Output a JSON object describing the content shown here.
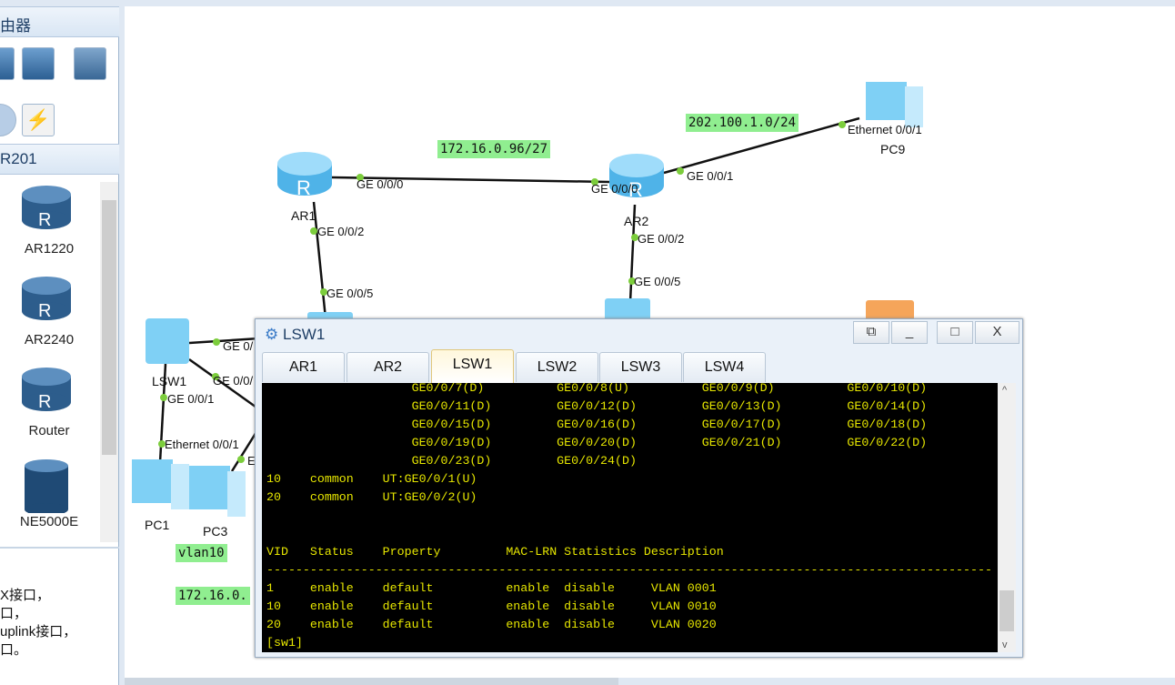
{
  "left_panel": {
    "section_title": "由器",
    "device_family": "R201",
    "devices": [
      {
        "label": "AR1220"
      },
      {
        "label": "AR2240"
      },
      {
        "label": "Router"
      },
      {
        "label": "NE5000E"
      }
    ],
    "description_lines": [
      "X接口，",
      "口，",
      "uplink接口，",
      "口。"
    ]
  },
  "topology": {
    "networks": [
      "172.16.0.96/27",
      "202.100.1.0/24",
      "vlan10",
      "172.16.0."
    ],
    "devices": {
      "ar1": "AR1",
      "ar2": "AR2",
      "lsw1": "LSW1",
      "pc1": "PC1",
      "pc3": "PC3",
      "pc9": "PC9"
    },
    "ports": {
      "ar1_g0": "GE 0/0/0",
      "ar2_g0": "GE 0/0/0",
      "ar2_g1": "GE 0/0/1",
      "pc9_e": "Ethernet 0/0/1",
      "ar1_g2": "GE 0/0/2",
      "sw_g5a": "GE 0/0/5",
      "ar2_g2": "GE 0/0/2",
      "sw_g5b": "GE 0/0/5",
      "lsw1_a": "GE 0/",
      "lsw1_b": "GE 0/0/",
      "lsw1_g1": "GE 0/0/1",
      "pc1_e": "Ethernet 0/0/1",
      "pc3_e": "E"
    }
  },
  "console": {
    "title": "LSW1",
    "buttons": {
      "restore": "⧉",
      "minimize": "_",
      "maximize": "□",
      "close": "X"
    },
    "tabs": [
      {
        "label": "AR1"
      },
      {
        "label": "AR2"
      },
      {
        "label": "LSW1",
        "active": true
      },
      {
        "label": "LSW2"
      },
      {
        "label": "LSW3"
      },
      {
        "label": "LSW4"
      }
    ],
    "output": "                    GE0/0/7(D)          GE0/0/8(U)          GE0/0/9(D)          GE0/0/10(D)\n                    GE0/0/11(D)         GE0/0/12(D)         GE0/0/13(D)         GE0/0/14(D)\n                    GE0/0/15(D)         GE0/0/16(D)         GE0/0/17(D)         GE0/0/18(D)\n                    GE0/0/19(D)         GE0/0/20(D)         GE0/0/21(D)         GE0/0/22(D)\n                    GE0/0/23(D)         GE0/0/24(D)\n10    common    UT:GE0/0/1(U)\n20    common    UT:GE0/0/2(U)\n\n\nVID   Status    Property         MAC-LRN Statistics Description\n----------------------------------------------------------------------------------------------------\n1     enable    default          enable  disable     VLAN 0001\n10    enable    default          enable  disable     VLAN 0010\n20    enable    default          enable  disable     VLAN 0020\n[sw1]"
  }
}
